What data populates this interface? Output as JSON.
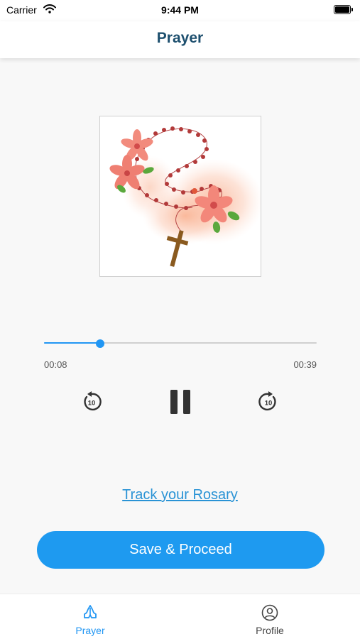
{
  "status_bar": {
    "carrier": "Carrier",
    "time": "9:44 PM",
    "icons": [
      "wifi-icon",
      "battery-icon"
    ]
  },
  "header": {
    "title": "Prayer",
    "title_color": "#1d4f6e"
  },
  "artwork": {
    "description_icon": "rosary-flowers-image"
  },
  "player": {
    "elapsed": "00:08",
    "total": "00:39",
    "progress_fraction": 0.205,
    "accent": "#2196f3",
    "controls": {
      "rewind_icon": "replay-10-icon",
      "rewind_seconds": "10",
      "pause_icon": "pause-icon",
      "forward_icon": "forward-10-icon",
      "forward_seconds": "10"
    }
  },
  "actions": {
    "track_link": "Track your Rosary",
    "save_label": "Save & Proceed",
    "save_color": "#1e9af0"
  },
  "tab_bar": {
    "tabs": [
      {
        "label": "Prayer",
        "icon": "praying-hands-icon",
        "active": true
      },
      {
        "label": "Profile",
        "icon": "profile-icon",
        "active": false
      }
    ]
  }
}
